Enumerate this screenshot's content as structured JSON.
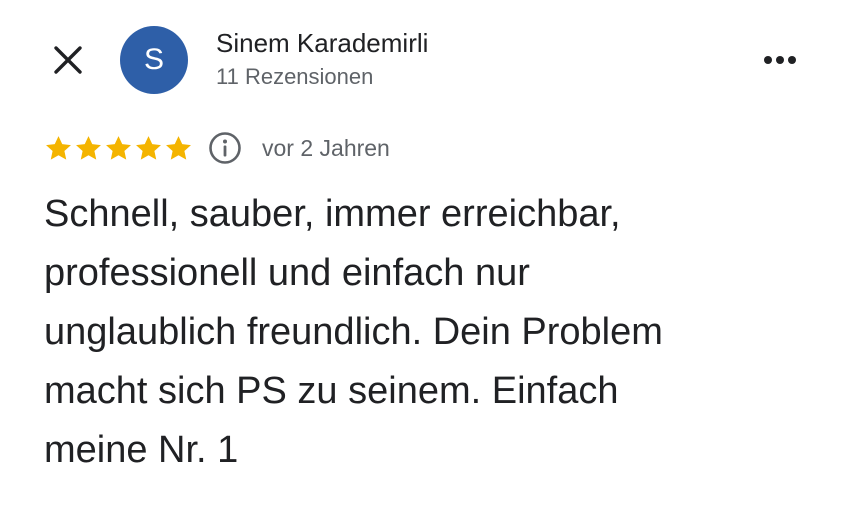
{
  "header": {
    "close_icon": "close-icon",
    "avatar_letter": "S",
    "avatar_color": "#2e5fa8",
    "author_name": "Sinem Karademirli",
    "review_count": "11 Rezensionen",
    "more_icon": "more-horizontal-icon"
  },
  "rating": {
    "stars": 5,
    "max_stars": 5,
    "star_color": "#f4b400",
    "info_icon": "info-icon",
    "date": "vor 2 Jahren"
  },
  "review": {
    "lines": [
      "Schnell, sauber, immer erreichbar,",
      "professionell und einfach nur",
      "unglaublich freundlich. Dein Problem",
      "macht sich PS zu seinem. Einfach",
      "meine Nr. 1"
    ]
  }
}
